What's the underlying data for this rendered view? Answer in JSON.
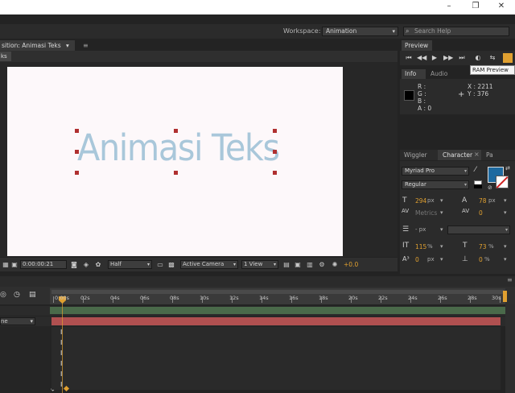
{
  "window": {
    "minimize_icon": "minimize-icon",
    "restore_icon": "restore-icon",
    "close_icon": "close-icon"
  },
  "workspace": {
    "label": "Workspace:",
    "value": "Animation",
    "search_placeholder": "Search Help"
  },
  "composition": {
    "tab_label": "sition: Animasi Teks",
    "sub_tab": "ks",
    "text": "Animasi Teks",
    "timecode": "0:00:00:21",
    "resolution": "Half",
    "camera": "Active Camera",
    "views": "1 View",
    "exposure": "+0.0"
  },
  "preview": {
    "tab": "Preview",
    "tooltip": "RAM Preview"
  },
  "info": {
    "tab": "Info",
    "audio_tab": "Audio",
    "r": "R :",
    "g": "G :",
    "b": "B :",
    "a": "A : 0",
    "x": "X : 2211",
    "y": "Y : 376"
  },
  "character": {
    "wiggler_tab": "Wiggler",
    "tab": "Character",
    "pa_tab": "Pa",
    "font": "Myriad Pro",
    "style": "Regular",
    "size": "294",
    "size_unit": "px",
    "leading": "78",
    "leading_unit": "px",
    "kerning": "Metrics",
    "tracking": "0",
    "stroke_width_unit": "- px",
    "vscale": "115",
    "hscale": "73",
    "pct": "%",
    "baseline": "0",
    "baseline_unit": "px",
    "tsume": "0",
    "tsume_unit": "%"
  },
  "timeline": {
    "ruler": [
      "0:00s",
      "02s",
      "04s",
      "06s",
      "08s",
      "10s",
      "12s",
      "14s",
      "16s",
      "18s",
      "20s",
      "22s",
      "24s",
      "26s",
      "28s",
      "30s"
    ],
    "layer_field": "ne",
    "keyframe_glyph": "I"
  },
  "colors": {
    "accent": "#e0a030",
    "text_color": "#a9c7da",
    "layer_bar": "#b05050",
    "fill": "#1e6aa0"
  }
}
